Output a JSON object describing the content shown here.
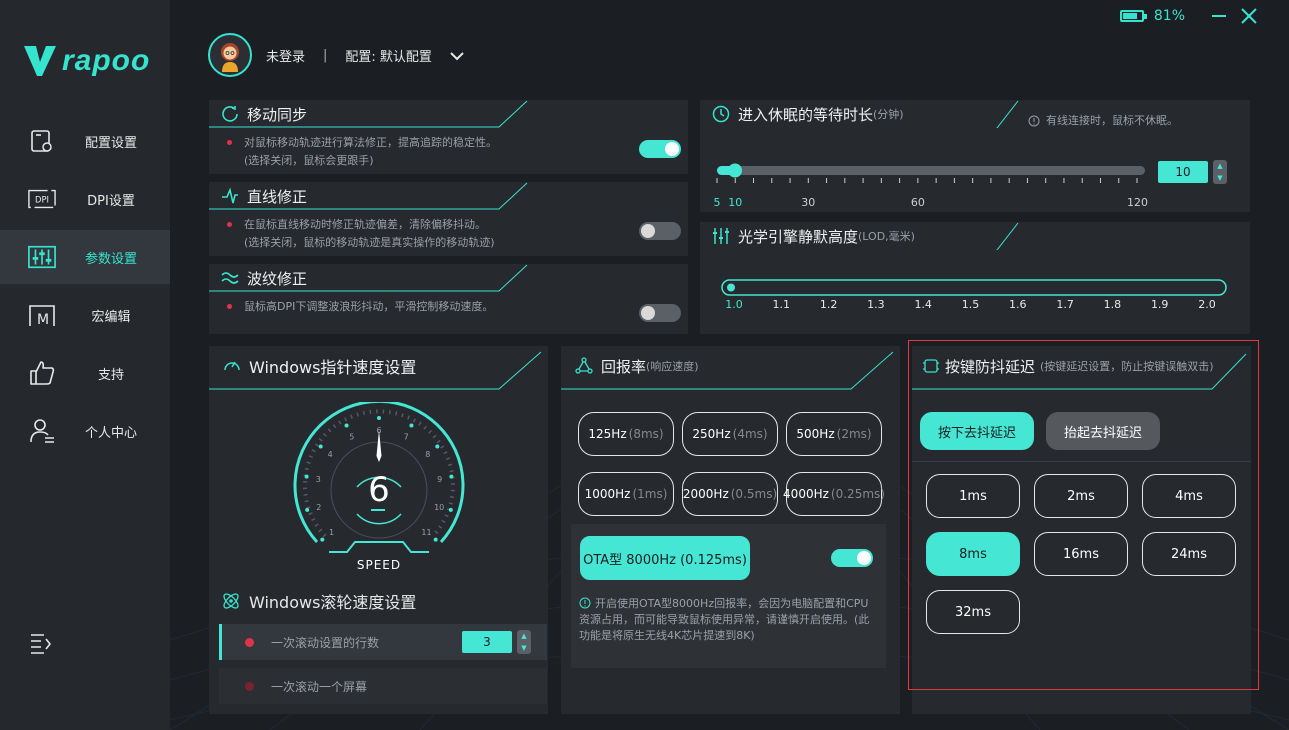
{
  "brand": {
    "name": "rapoo"
  },
  "colors": {
    "accent": "#45e6d3",
    "sidebar": "#25282d",
    "panel": "#26292e",
    "bullet": "#e0334a"
  },
  "window": {
    "battery": "81%",
    "battery_level": 0.81
  },
  "sidebar": {
    "items": [
      {
        "label": "配置设置",
        "icon": "mouse-config-icon"
      },
      {
        "label": "DPI设置",
        "icon": "dpi-icon"
      },
      {
        "label": "参数设置",
        "icon": "sliders-icon"
      },
      {
        "label": "宏编辑",
        "icon": "macro-icon"
      },
      {
        "label": "支持",
        "icon": "thumbs-up-icon"
      },
      {
        "label": "个人中心",
        "icon": "user-center-icon"
      }
    ],
    "active": "参数设置"
  },
  "user": {
    "name": "未登录",
    "sep": "|",
    "config": "配置: 默认配置"
  },
  "motion_sync": {
    "title": "移动同步",
    "desc1": "对鼠标移动轨迹进行算法修正，提高追踪的稳定性。",
    "desc2": "(选择关闭，鼠标会更跟手)",
    "enabled": true
  },
  "angle_snap": {
    "title": "直线修正",
    "desc1": "在鼠标直线移动时修正轨迹偏差，清除偏移抖动。",
    "desc2": "(选择关闭，鼠标的移动轨迹是真实操作的移动轨迹)",
    "enabled": false
  },
  "ripple": {
    "title": "波纹修正",
    "desc1": "鼠标高DPI下调整波浪形抖动，平滑控制移动速度。",
    "enabled": false
  },
  "sleep": {
    "title": "进入休眠的等待时长",
    "unit": "(分钟)",
    "note": "有线连接时，鼠标不休眠。",
    "value": "10",
    "ticks": [
      "5",
      "10",
      "30",
      "60",
      "120"
    ]
  },
  "lod": {
    "title": "光学引擎静默高度",
    "unit": "(LOD,毫米)",
    "ticks": [
      "1.0",
      "1.1",
      "1.2",
      "1.3",
      "1.4",
      "1.5",
      "1.6",
      "1.7",
      "1.8",
      "1.9",
      "2.0"
    ],
    "selected": "1.0"
  },
  "pointer": {
    "title": "Windows指针速度设置",
    "value": "6",
    "label": "SPEED",
    "dial_ticks": [
      "1",
      "2",
      "3",
      "4",
      "5",
      "6",
      "7",
      "8",
      "9",
      "10",
      "11"
    ]
  },
  "scroll": {
    "title": "Windows滚轮速度设置",
    "row1": "一次滚动设置的行数",
    "row1_value": "3",
    "row2": "一次滚动一个屏幕"
  },
  "polling": {
    "title": "回报率",
    "sub": "(响应速度)",
    "rates": [
      {
        "hz": "125Hz",
        "ms": "(8ms)"
      },
      {
        "hz": "250Hz",
        "ms": "(4ms)"
      },
      {
        "hz": "500Hz",
        "ms": "(2ms)"
      },
      {
        "hz": "1000Hz",
        "ms": "(1ms)"
      },
      {
        "hz": "2000Hz",
        "ms": "(0.5ms)"
      },
      {
        "hz": "4000Hz",
        "ms": "(0.25ms)"
      }
    ],
    "ota_label": "OTA型 8000Hz (0.125ms)",
    "ota_enabled": true,
    "note": "开启使用OTA型8000Hz回报率，会因为电脑配置和CPU资源占用，而可能导致鼠标使用异常，请谨慎开启使用。(此功能是将原生无线4K芯片提速到8K)"
  },
  "debounce": {
    "title": "按键防抖延迟",
    "sub": "(按键延迟设置，防止按键误触双击)",
    "tab_press": "按下去抖延迟",
    "tab_release": "抬起去抖延迟",
    "options": [
      "1ms",
      "2ms",
      "4ms",
      "8ms",
      "16ms",
      "24ms",
      "32ms"
    ],
    "selected": "8ms"
  }
}
